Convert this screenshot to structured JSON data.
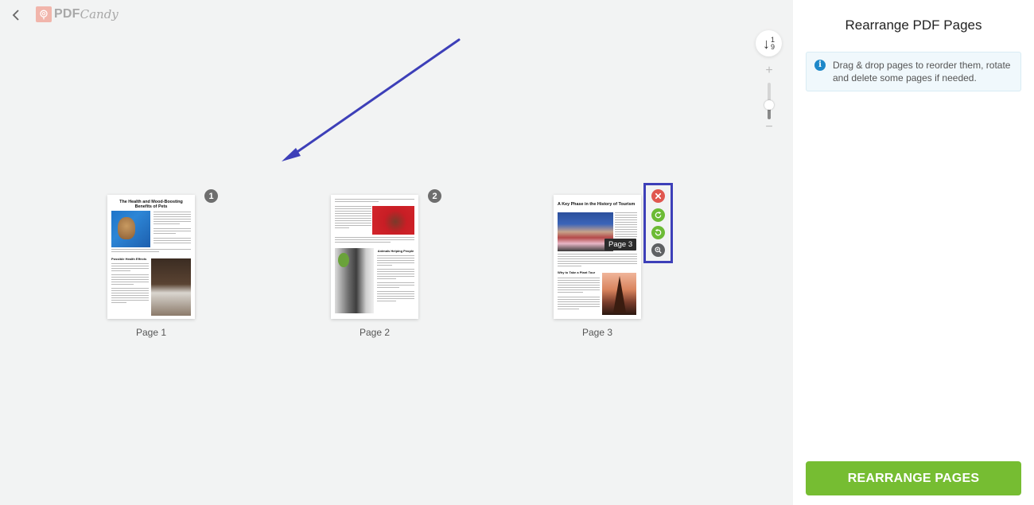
{
  "app": {
    "brand": {
      "primary": "PDF",
      "script": "Candy"
    },
    "back_label": "Back"
  },
  "toolbar": {
    "sort_icon": "sort-ascending-icon",
    "sort_digits": [
      "1",
      "9"
    ],
    "zoom_in": "+",
    "zoom_out": "−",
    "zoom_level": 0.4
  },
  "pages": [
    {
      "number": "1",
      "label": "Page 1",
      "title": "The Health and Mood-Boosting Benefits of Pets",
      "subheading": "Possible Health Effects"
    },
    {
      "number": "2",
      "label": "Page 2",
      "title": "",
      "subheading": "Animals Helping People"
    },
    {
      "number": "3",
      "label": "Page 3",
      "title": "A Key Phase in the History of Tourism",
      "subheading": "Why to Take a Plant Tour",
      "tooltip": "Page 3"
    }
  ],
  "page_actions": [
    {
      "name": "delete-page",
      "icon": "close-icon",
      "color": "#e0574f"
    },
    {
      "name": "rotate-clockwise",
      "icon": "rotate-cw-icon",
      "color": "#6cbb35"
    },
    {
      "name": "rotate-counterclockwise",
      "icon": "rotate-ccw-icon",
      "color": "#6cbb35"
    },
    {
      "name": "zoom-page",
      "icon": "zoom-in-icon",
      "color": "#5f6163"
    }
  ],
  "annotation": {
    "highlight_color": "#3d3fb8"
  },
  "sidebar": {
    "title": "Rearrange PDF Pages",
    "info": "Drag & drop pages to reorder them, rotate and delete some pages if needed.",
    "cta_label": "REARRANGE PAGES",
    "cta_color": "#76bd32"
  }
}
